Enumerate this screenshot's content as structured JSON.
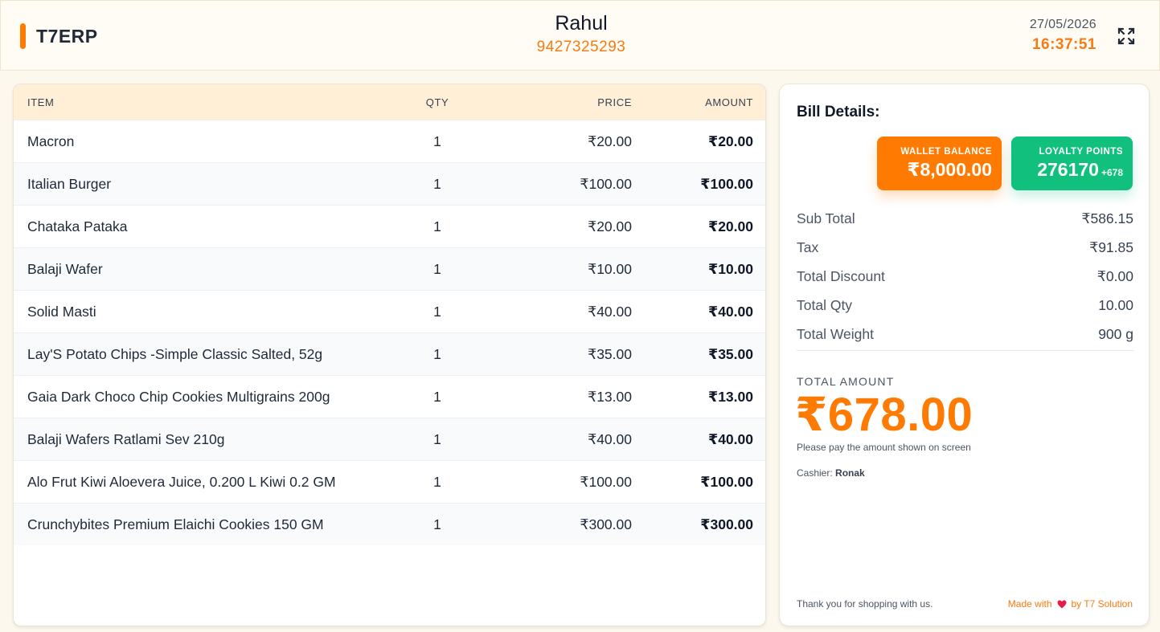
{
  "header": {
    "brand": "T7ERP",
    "customer_name": "Rahul",
    "customer_phone": "9427325293",
    "date": "27/05/2026",
    "time": "16:37:51"
  },
  "table": {
    "columns": [
      "ITEM",
      "QTY",
      "PRICE",
      "AMOUNT"
    ],
    "rows": [
      {
        "item": "Macron",
        "qty": "1",
        "price": "₹20.00",
        "amount": "₹20.00"
      },
      {
        "item": "Italian Burger",
        "qty": "1",
        "price": "₹100.00",
        "amount": "₹100.00"
      },
      {
        "item": "Chataka Pataka",
        "qty": "1",
        "price": "₹20.00",
        "amount": "₹20.00"
      },
      {
        "item": "Balaji Wafer",
        "qty": "1",
        "price": "₹10.00",
        "amount": "₹10.00"
      },
      {
        "item": "Solid Masti",
        "qty": "1",
        "price": "₹40.00",
        "amount": "₹40.00"
      },
      {
        "item": "Lay'S Potato Chips -Simple Classic Salted, 52g",
        "qty": "1",
        "price": "₹35.00",
        "amount": "₹35.00"
      },
      {
        "item": "Gaia Dark Choco Chip Cookies Multigrains 200g",
        "qty": "1",
        "price": "₹13.00",
        "amount": "₹13.00"
      },
      {
        "item": "Balaji Wafers Ratlami Sev 210g",
        "qty": "1",
        "price": "₹40.00",
        "amount": "₹40.00"
      },
      {
        "item": "Alo Frut Kiwi Aloevera Juice, 0.200 L Kiwi 0.2 GM",
        "qty": "1",
        "price": "₹100.00",
        "amount": "₹100.00"
      },
      {
        "item": "Crunchybites Premium Elaichi Cookies 150 GM",
        "qty": "1",
        "price": "₹300.00",
        "amount": "₹300.00"
      }
    ]
  },
  "bill": {
    "title": "Bill Details:",
    "wallet_label": "WALLET BALANCE",
    "wallet_value": "₹8,000.00",
    "loyalty_label": "LOYALTY POINTS",
    "loyalty_value": "276170",
    "loyalty_delta": "+678",
    "summary": [
      {
        "label": "Sub Total",
        "value": "₹586.15"
      },
      {
        "label": "Tax",
        "value": "₹91.85"
      },
      {
        "label": "Total Discount",
        "value": "₹0.00"
      },
      {
        "label": "Total Qty",
        "value": "10.00"
      },
      {
        "label": "Total Weight",
        "value": "900 g"
      }
    ],
    "total_label": "TOTAL AMOUNT",
    "total_value": "₹678.00",
    "pay_note": "Please pay the amount shown on screen",
    "cashier_label": "Cashier:",
    "cashier_name": "Ronak",
    "thanks": "Thank you for shopping with us.",
    "made_with": "Made with",
    "made_by": "by T7 Solution"
  },
  "colors": {
    "accent": "#ff7a00",
    "loyalty": "#12c07e",
    "heart": "#e11d48"
  },
  "icons": {
    "fullscreen": "fullscreen-icon",
    "heart": "heart-icon"
  }
}
